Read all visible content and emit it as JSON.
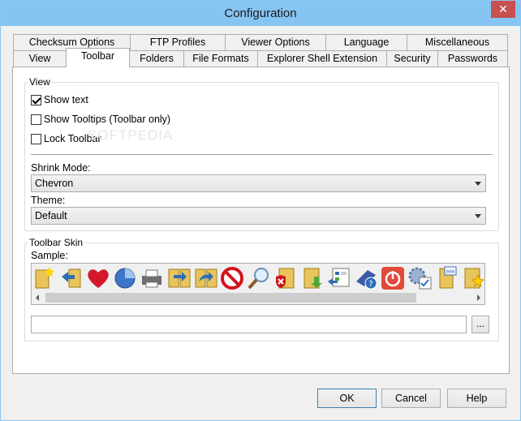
{
  "window": {
    "title": "Configuration",
    "close_glyph": "✕"
  },
  "tabs_row1": [
    {
      "label": "Checksum Options"
    },
    {
      "label": "FTP Profiles"
    },
    {
      "label": "Viewer Options"
    },
    {
      "label": "Language"
    },
    {
      "label": "Miscellaneous"
    }
  ],
  "tabs_row2": [
    {
      "label": "View"
    },
    {
      "label": "Toolbar",
      "active": true
    },
    {
      "label": "Folders"
    },
    {
      "label": "File Formats"
    },
    {
      "label": "Explorer Shell Extension"
    },
    {
      "label": "Security"
    },
    {
      "label": "Passwords"
    }
  ],
  "view_group": {
    "label": "View",
    "show_text": {
      "label": "Show text",
      "checked": true
    },
    "show_tooltips": {
      "label": "Show Tooltips (Toolbar only)",
      "checked": false
    },
    "lock_toolbar": {
      "label": "Lock Toolbar",
      "checked": false
    },
    "shrink_mode_label": "Shrink Mode:",
    "shrink_mode_value": "Chevron",
    "theme_label": "Theme:",
    "theme_value": "Default"
  },
  "skin_group": {
    "label": "Toolbar Skin",
    "sample_label": "Sample:",
    "skin_path_value": "",
    "browse_label": "...",
    "icons": [
      "new-folder-icon",
      "back-folder-icon",
      "favorite-heart-icon",
      "disk-usage-icon",
      "print-icon",
      "copy-to-folder-icon",
      "move-to-folder-icon",
      "stop-icon",
      "search-icon",
      "delete-folder-icon",
      "extract-folder-icon",
      "properties-icon",
      "help-book-icon",
      "power-icon",
      "settings-gear-icon",
      "checksum-icon",
      "star-folder-icon",
      "mail-icon"
    ]
  },
  "buttons": {
    "ok": "OK",
    "cancel": "Cancel",
    "help": "Help"
  },
  "watermark": "SOFTPEDIA",
  "colors": {
    "titlebar": "#86c4f2",
    "close": "#c75050",
    "accent": "#3c7fb1"
  }
}
